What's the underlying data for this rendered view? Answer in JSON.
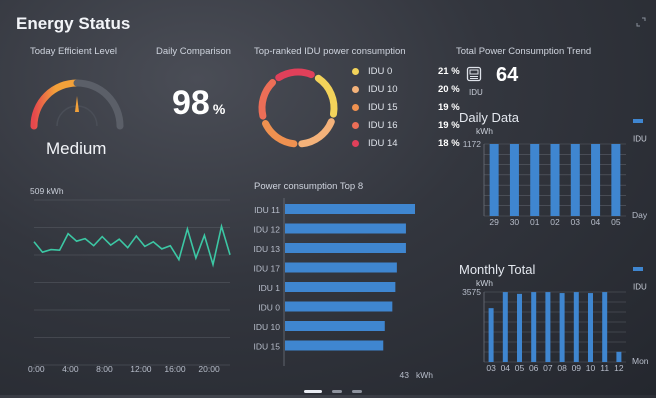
{
  "header": {
    "title": "Energy Status"
  },
  "efficiency": {
    "title": "Today Efficient Level",
    "level": "Medium",
    "gauge_fraction": 0.5
  },
  "daily_comparison": {
    "title": "Daily Comparison",
    "value": "98",
    "unit": "%"
  },
  "top_ranked": {
    "title": "Top-ranked IDU power consumption",
    "items": [
      {
        "label": "IDU 0",
        "pct": "21 %",
        "value": 21,
        "color": "#f3d35a"
      },
      {
        "label": "IDU 10",
        "pct": "20 %",
        "value": 20,
        "color": "#f4b27a"
      },
      {
        "label": "IDU 15",
        "pct": "19 %",
        "value": 19,
        "color": "#ef9150"
      },
      {
        "label": "IDU 16",
        "pct": "19 %",
        "value": 19,
        "color": "#ec6e57"
      },
      {
        "label": "IDU 14",
        "pct": "18 %",
        "value": 18,
        "color": "#e0405a"
      }
    ]
  },
  "total_trend": {
    "title": "Total Power Consumption Trend",
    "count": "64",
    "count_label": "IDU",
    "icon": "air-conditioner-icon",
    "expand_icon": "expand-icon"
  },
  "line_chart": {
    "ymax_label": "509 kWh",
    "x_labels": [
      "0:00",
      "4:00",
      "8:00",
      "12:00",
      "16:00",
      "20:00"
    ],
    "color": "#3cc7a4"
  },
  "top8": {
    "title": "Power consumption Top 8",
    "max_label": "43",
    "unit": "kWh",
    "color": "#3f86d0"
  },
  "daily_data": {
    "title": "Daily Data",
    "unit": "kWh",
    "ymax": "1172",
    "axis_name": "Day",
    "legend": "IDU",
    "color": "#3f86d0"
  },
  "monthly_total": {
    "title": "Monthly Total",
    "unit": "kWh",
    "ymax": "3575",
    "axis_name": "Mon",
    "legend": "IDU",
    "color": "#3f86d0"
  },
  "pager": {
    "pages": 3,
    "active": 0
  },
  "chart_data": [
    {
      "type": "line",
      "name": "hourly-consumption",
      "y_top_label": "509 kWh",
      "x": [
        "0:00",
        "1:00",
        "2:00",
        "3:00",
        "4:00",
        "5:00",
        "6:00",
        "7:00",
        "8:00",
        "9:00",
        "10:00",
        "11:00",
        "12:00",
        "13:00",
        "14:00",
        "15:00",
        "16:00",
        "17:00",
        "18:00",
        "19:00",
        "20:00",
        "21:00",
        "22:00",
        "23:00"
      ],
      "y": [
        380,
        348,
        356,
        354,
        405,
        382,
        390,
        368,
        396,
        370,
        388,
        362,
        398,
        366,
        380,
        358,
        368,
        325,
        420,
        330,
        400,
        310,
        428,
        340
      ],
      "ylim": [
        0,
        509
      ],
      "xticks": [
        "0:00",
        "4:00",
        "8:00",
        "12:00",
        "16:00",
        "20:00"
      ]
    },
    {
      "type": "bar",
      "orientation": "horizontal",
      "name": "power-consumption-top8",
      "categories": [
        "IDU 11",
        "IDU 12",
        "IDU 13",
        "IDU 17",
        "IDU 1",
        "IDU 0",
        "IDU 10",
        "IDU 15"
      ],
      "values": [
        43,
        40,
        40,
        37,
        36.5,
        35.5,
        33,
        32.5
      ],
      "xmax": 43,
      "unit": "kWh"
    },
    {
      "type": "bar",
      "name": "daily-data",
      "categories": [
        "29",
        "30",
        "01",
        "02",
        "03",
        "04",
        "05"
      ],
      "values": [
        1172,
        1172,
        1172,
        1172,
        1172,
        1172,
        1172
      ],
      "ylabel": "kWh",
      "xlabel": "Day",
      "ylim": [
        0,
        1172
      ],
      "legend": "IDU"
    },
    {
      "type": "bar",
      "name": "monthly-total",
      "categories": [
        "03",
        "04",
        "05",
        "06",
        "07",
        "08",
        "09",
        "10",
        "11",
        "12"
      ],
      "tick_labels": [
        "03",
        "04",
        "05",
        "06",
        "07",
        "08",
        "09",
        "10",
        "11",
        "12"
      ],
      "values": [
        2750,
        3570,
        3480,
        3570,
        3570,
        3520,
        3570,
        3520,
        3570,
        520
      ],
      "ylabel": "kWh",
      "xlabel": "Mon",
      "ylim": [
        0,
        3575
      ],
      "legend": "IDU"
    }
  ]
}
